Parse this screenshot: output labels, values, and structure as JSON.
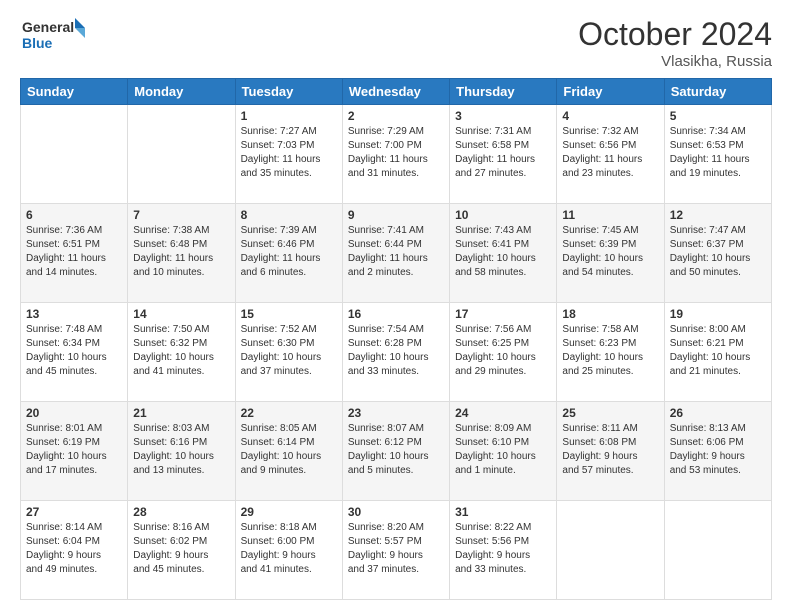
{
  "header": {
    "logo_line1": "General",
    "logo_line2": "Blue",
    "month": "October 2024",
    "location": "Vlasikha, Russia"
  },
  "days_of_week": [
    "Sunday",
    "Monday",
    "Tuesday",
    "Wednesday",
    "Thursday",
    "Friday",
    "Saturday"
  ],
  "weeks": [
    [
      {
        "day": "",
        "info": ""
      },
      {
        "day": "",
        "info": ""
      },
      {
        "day": "1",
        "info": "Sunrise: 7:27 AM\nSunset: 7:03 PM\nDaylight: 11 hours\nand 35 minutes."
      },
      {
        "day": "2",
        "info": "Sunrise: 7:29 AM\nSunset: 7:00 PM\nDaylight: 11 hours\nand 31 minutes."
      },
      {
        "day": "3",
        "info": "Sunrise: 7:31 AM\nSunset: 6:58 PM\nDaylight: 11 hours\nand 27 minutes."
      },
      {
        "day": "4",
        "info": "Sunrise: 7:32 AM\nSunset: 6:56 PM\nDaylight: 11 hours\nand 23 minutes."
      },
      {
        "day": "5",
        "info": "Sunrise: 7:34 AM\nSunset: 6:53 PM\nDaylight: 11 hours\nand 19 minutes."
      }
    ],
    [
      {
        "day": "6",
        "info": "Sunrise: 7:36 AM\nSunset: 6:51 PM\nDaylight: 11 hours\nand 14 minutes."
      },
      {
        "day": "7",
        "info": "Sunrise: 7:38 AM\nSunset: 6:48 PM\nDaylight: 11 hours\nand 10 minutes."
      },
      {
        "day": "8",
        "info": "Sunrise: 7:39 AM\nSunset: 6:46 PM\nDaylight: 11 hours\nand 6 minutes."
      },
      {
        "day": "9",
        "info": "Sunrise: 7:41 AM\nSunset: 6:44 PM\nDaylight: 11 hours\nand 2 minutes."
      },
      {
        "day": "10",
        "info": "Sunrise: 7:43 AM\nSunset: 6:41 PM\nDaylight: 10 hours\nand 58 minutes."
      },
      {
        "day": "11",
        "info": "Sunrise: 7:45 AM\nSunset: 6:39 PM\nDaylight: 10 hours\nand 54 minutes."
      },
      {
        "day": "12",
        "info": "Sunrise: 7:47 AM\nSunset: 6:37 PM\nDaylight: 10 hours\nand 50 minutes."
      }
    ],
    [
      {
        "day": "13",
        "info": "Sunrise: 7:48 AM\nSunset: 6:34 PM\nDaylight: 10 hours\nand 45 minutes."
      },
      {
        "day": "14",
        "info": "Sunrise: 7:50 AM\nSunset: 6:32 PM\nDaylight: 10 hours\nand 41 minutes."
      },
      {
        "day": "15",
        "info": "Sunrise: 7:52 AM\nSunset: 6:30 PM\nDaylight: 10 hours\nand 37 minutes."
      },
      {
        "day": "16",
        "info": "Sunrise: 7:54 AM\nSunset: 6:28 PM\nDaylight: 10 hours\nand 33 minutes."
      },
      {
        "day": "17",
        "info": "Sunrise: 7:56 AM\nSunset: 6:25 PM\nDaylight: 10 hours\nand 29 minutes."
      },
      {
        "day": "18",
        "info": "Sunrise: 7:58 AM\nSunset: 6:23 PM\nDaylight: 10 hours\nand 25 minutes."
      },
      {
        "day": "19",
        "info": "Sunrise: 8:00 AM\nSunset: 6:21 PM\nDaylight: 10 hours\nand 21 minutes."
      }
    ],
    [
      {
        "day": "20",
        "info": "Sunrise: 8:01 AM\nSunset: 6:19 PM\nDaylight: 10 hours\nand 17 minutes."
      },
      {
        "day": "21",
        "info": "Sunrise: 8:03 AM\nSunset: 6:16 PM\nDaylight: 10 hours\nand 13 minutes."
      },
      {
        "day": "22",
        "info": "Sunrise: 8:05 AM\nSunset: 6:14 PM\nDaylight: 10 hours\nand 9 minutes."
      },
      {
        "day": "23",
        "info": "Sunrise: 8:07 AM\nSunset: 6:12 PM\nDaylight: 10 hours\nand 5 minutes."
      },
      {
        "day": "24",
        "info": "Sunrise: 8:09 AM\nSunset: 6:10 PM\nDaylight: 10 hours\nand 1 minute."
      },
      {
        "day": "25",
        "info": "Sunrise: 8:11 AM\nSunset: 6:08 PM\nDaylight: 9 hours\nand 57 minutes."
      },
      {
        "day": "26",
        "info": "Sunrise: 8:13 AM\nSunset: 6:06 PM\nDaylight: 9 hours\nand 53 minutes."
      }
    ],
    [
      {
        "day": "27",
        "info": "Sunrise: 8:14 AM\nSunset: 6:04 PM\nDaylight: 9 hours\nand 49 minutes."
      },
      {
        "day": "28",
        "info": "Sunrise: 8:16 AM\nSunset: 6:02 PM\nDaylight: 9 hours\nand 45 minutes."
      },
      {
        "day": "29",
        "info": "Sunrise: 8:18 AM\nSunset: 6:00 PM\nDaylight: 9 hours\nand 41 minutes."
      },
      {
        "day": "30",
        "info": "Sunrise: 8:20 AM\nSunset: 5:57 PM\nDaylight: 9 hours\nand 37 minutes."
      },
      {
        "day": "31",
        "info": "Sunrise: 8:22 AM\nSunset: 5:56 PM\nDaylight: 9 hours\nand 33 minutes."
      },
      {
        "day": "",
        "info": ""
      },
      {
        "day": "",
        "info": ""
      }
    ]
  ]
}
